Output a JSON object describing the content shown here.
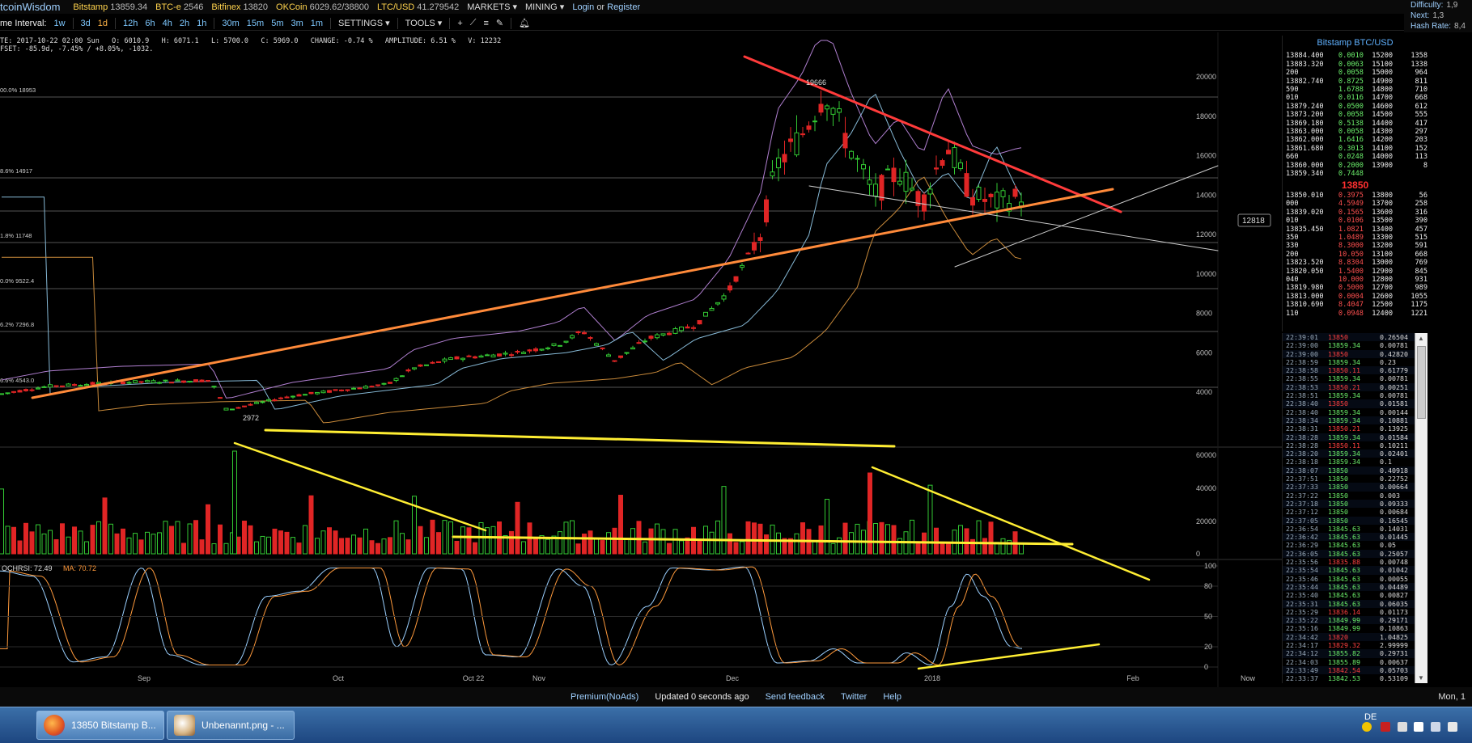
{
  "topbar": {
    "brand": "tcoinWisdom",
    "markets": [
      {
        "name": "Bitstamp",
        "value": "13859.34"
      },
      {
        "name": "BTC-e",
        "value": "2546"
      },
      {
        "name": "Bitfinex",
        "value": "13820"
      },
      {
        "name": "OKCoin",
        "value": "6029.62/38800"
      },
      {
        "name": "LTC/USD",
        "value": "41.279542"
      }
    ],
    "menus": [
      "MARKETS",
      "MINING"
    ],
    "login": "Login",
    "or": "or",
    "register": "Register"
  },
  "hashbox": {
    "difficulty_label": "Difficulty:",
    "difficulty_value": "1,9",
    "next_label": "Next:",
    "next_value": "1,3",
    "hashrate_label": "Hash Rate:",
    "hashrate_value": "8,4"
  },
  "toolbar": {
    "interval_label": "me Interval:",
    "intervals": [
      "1w",
      "3d",
      "1d",
      "12h",
      "6h",
      "4h",
      "2h",
      "1h",
      "30m",
      "15m",
      "5m",
      "3m",
      "1m"
    ],
    "active_interval": "1d",
    "settings": "SETTINGS",
    "tools": "TOOLS"
  },
  "infobar": {
    "line1": "TE: 2017-10-22 02:00 Sun   O: 6010.9   H: 6071.1   L: 5700.0   C: 5969.0   CHANGE: -0.74 %   AMPLITUDE: 6.51 %   V: 12232",
    "line2": "FSET: -85.9d, -7.45% / +8.05%, -1032."
  },
  "chart": {
    "price_axis": [
      "20000",
      "18000",
      "16000",
      "14000",
      "12000",
      "10000",
      "8000",
      "6000",
      "4000"
    ],
    "price_marker": "12818",
    "high_label": "19666",
    "low_label": "2972",
    "fib_labels": [
      "00.0% 18953",
      "8.6% 14917",
      "1.8% 11748",
      "0.0% 9522.4",
      "6.2% 7296.8",
      "6.6% 4543.0"
    ],
    "volume_axis": [
      "60000",
      "40000",
      "20000",
      "0"
    ],
    "rsi_label": "OCHRSI: 72.49",
    "rsi_ma_label": "MA: 70.72",
    "rsi_axis": [
      "100",
      "80",
      "50",
      "20",
      "0"
    ],
    "time_axis": [
      "Sep",
      "Oct",
      "Oct 22",
      "Nov",
      "Dec",
      "2018",
      "Feb",
      "Now"
    ]
  },
  "orderbook": {
    "title": "Bitstamp BTC/USD",
    "asks": [
      [
        "13884.400",
        "0.0010",
        "15200",
        "1358"
      ],
      [
        "13883.320",
        "0.0063",
        "15100",
        "1338"
      ],
      [
        "200",
        "0.0058",
        "15000",
        "964"
      ],
      [
        "13882.740",
        "0.8725",
        "14900",
        "811"
      ],
      [
        "590",
        "1.6788",
        "14800",
        "710"
      ],
      [
        "010",
        "0.0116",
        "14700",
        "668"
      ],
      [
        "13879.240",
        "0.0500",
        "14600",
        "612"
      ],
      [
        "13873.200",
        "0.0058",
        "14500",
        "555"
      ],
      [
        "13869.180",
        "0.5138",
        "14400",
        "417"
      ],
      [
        "13863.000",
        "0.0058",
        "14300",
        "297"
      ],
      [
        "13862.000",
        "1.6416",
        "14200",
        "203"
      ],
      [
        "13861.680",
        "0.3013",
        "14100",
        "152"
      ],
      [
        "660",
        "0.0248",
        "14000",
        "113"
      ],
      [
        "13860.000",
        "0.2000",
        "13900",
        "8"
      ],
      [
        "13859.340",
        "0.7448",
        "",
        ""
      ]
    ],
    "mid": "13850",
    "bids": [
      [
        "13850.010",
        "0.3975",
        "13800",
        "56"
      ],
      [
        "000",
        "4.5949",
        "13700",
        "258"
      ],
      [
        "13839.020",
        "0.1565",
        "13600",
        "316"
      ],
      [
        "010",
        "0.0106",
        "13500",
        "390"
      ],
      [
        "13835.450",
        "1.0821",
        "13400",
        "457"
      ],
      [
        "350",
        "1.0489",
        "13300",
        "515"
      ],
      [
        "330",
        "8.3000",
        "13200",
        "591"
      ],
      [
        "200",
        "10.050",
        "13100",
        "668"
      ],
      [
        "13823.520",
        "8.8304",
        "13000",
        "769"
      ],
      [
        "13820.050",
        "1.5400",
        "12900",
        "845"
      ],
      [
        "040",
        "10.000",
        "12800",
        "931"
      ],
      [
        "13819.980",
        "0.5000",
        "12700",
        "989"
      ],
      [
        "13813.000",
        "0.0004",
        "12600",
        "1055"
      ],
      [
        "13810.690",
        "8.4047",
        "12500",
        "1175"
      ],
      [
        "110",
        "0.0948",
        "12400",
        "1221"
      ]
    ]
  },
  "trades": [
    [
      "22:39:01",
      "13850",
      "r",
      "0.26504"
    ],
    [
      "22:39:00",
      "13859.34",
      "g",
      "0.00781"
    ],
    [
      "22:39:00",
      "13850",
      "r",
      "0.42820"
    ],
    [
      "22:38:59",
      "13859.34",
      "g",
      "0.23"
    ],
    [
      "22:38:58",
      "13850.11",
      "r",
      "0.61779"
    ],
    [
      "22:38:55",
      "13859.34",
      "g",
      "0.00781"
    ],
    [
      "22:38:53",
      "13850.21",
      "r",
      "0.00251"
    ],
    [
      "22:38:51",
      "13859.34",
      "g",
      "0.00781"
    ],
    [
      "22:38:40",
      "13850",
      "r",
      "0.01581"
    ],
    [
      "22:38:40",
      "13859.34",
      "g",
      "0.00144"
    ],
    [
      "22:38:34",
      "13859.34",
      "g",
      "0.10881"
    ],
    [
      "22:38:31",
      "13850.21",
      "r",
      "0.13925"
    ],
    [
      "22:38:28",
      "13859.34",
      "g",
      "0.01584"
    ],
    [
      "22:38:28",
      "13850.11",
      "r",
      "0.10211"
    ],
    [
      "22:38:20",
      "13859.34",
      "g",
      "0.02401"
    ],
    [
      "22:38:18",
      "13859.34",
      "g",
      "0.1"
    ],
    [
      "22:38:07",
      "13850",
      "g",
      "0.40918"
    ],
    [
      "22:37:51",
      "13850",
      "g",
      "0.22752"
    ],
    [
      "22:37:33",
      "13850",
      "g",
      "0.00664"
    ],
    [
      "22:37:22",
      "13850",
      "g",
      "0.003"
    ],
    [
      "22:37:18",
      "13850",
      "g",
      "0.09333"
    ],
    [
      "22:37:12",
      "13850",
      "g",
      "0.00684"
    ],
    [
      "22:37:05",
      "13850",
      "g",
      "0.16545"
    ],
    [
      "22:36:54",
      "13845.63",
      "g",
      "0.14031"
    ],
    [
      "22:36:42",
      "13845.63",
      "g",
      "0.01445"
    ],
    [
      "22:36:29",
      "13845.63",
      "g",
      "0.05"
    ],
    [
      "22:36:05",
      "13845.63",
      "g",
      "0.25057"
    ],
    [
      "22:35:56",
      "13835.88",
      "r",
      "0.00748"
    ],
    [
      "22:35:54",
      "13845.63",
      "g",
      "0.01042"
    ],
    [
      "22:35:46",
      "13845.63",
      "g",
      "0.00055"
    ],
    [
      "22:35:44",
      "13845.63",
      "g",
      "0.04489"
    ],
    [
      "22:35:40",
      "13845.63",
      "g",
      "0.00827"
    ],
    [
      "22:35:31",
      "13845.63",
      "g",
      "0.06035"
    ],
    [
      "22:35:29",
      "13836.14",
      "r",
      "0.01173"
    ],
    [
      "22:35:22",
      "13849.99",
      "g",
      "0.29171"
    ],
    [
      "22:35:16",
      "13849.99",
      "g",
      "0.10863"
    ],
    [
      "22:34:42",
      "13820",
      "r",
      "1.04825"
    ],
    [
      "22:34:17",
      "13829.32",
      "r",
      "2.99999"
    ],
    [
      "22:34:12",
      "13855.82",
      "g",
      "0.29731"
    ],
    [
      "22:34:03",
      "13855.89",
      "g",
      "0.00637"
    ],
    [
      "22:33:49",
      "13842.54",
      "r",
      "0.05703"
    ],
    [
      "22:33:37",
      "13842.53",
      "g",
      "0.53109"
    ]
  ],
  "footer": {
    "premium": "Premium(NoAds)",
    "updated": "Updated 0 seconds ago",
    "feedback": "Send feedback",
    "twitter": "Twitter",
    "help": "Help",
    "clock": "Mon, 1"
  },
  "taskbar": {
    "items": [
      "13850 Bitstamp B...",
      "Unbenannt.png - ..."
    ],
    "lang": "DE"
  }
}
